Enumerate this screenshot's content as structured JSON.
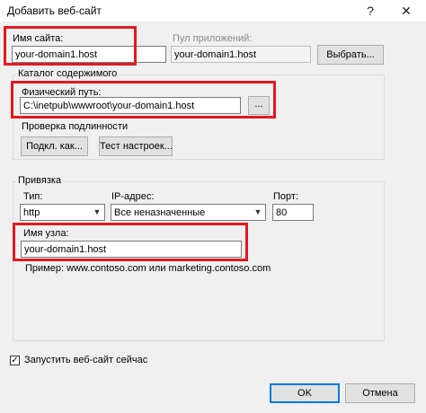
{
  "window": {
    "title": "Добавить веб-сайт",
    "help_glyph": "?",
    "close_glyph": "✕"
  },
  "site": {
    "name_label": "Имя сайта:",
    "name_value": "your-domain1.host",
    "pool_label": "Пул приложений:",
    "pool_value": "your-domain1.host",
    "select_button": "Выбрать..."
  },
  "content": {
    "group_label": "Каталог содержимого",
    "path_label": "Физический путь:",
    "path_value": "C:\\inetpub\\wwwroot\\your-domain1.host",
    "browse_button": "...",
    "auth_label": "Проверка подлинности",
    "connect_as_button": "Подкл. как...",
    "test_settings_button": "Тест настроек..."
  },
  "binding": {
    "group_label": "Привязка",
    "type_label": "Тип:",
    "type_value": "http",
    "ip_label": "IP-адрес:",
    "ip_value": "Все неназначенные",
    "port_label": "Порт:",
    "port_value": "80",
    "host_label": "Имя узла:",
    "host_value": "your-domain1.host",
    "example_text": "Пример: www.contoso.com или marketing.contoso.com"
  },
  "footer": {
    "start_checkbox_label": "Запустить веб-сайт сейчас",
    "start_checked": true,
    "ok_button": "OK",
    "cancel_button": "Отмена"
  },
  "colors": {
    "highlight": "#e3181f",
    "dialog_bg": "#f0f0f0"
  }
}
